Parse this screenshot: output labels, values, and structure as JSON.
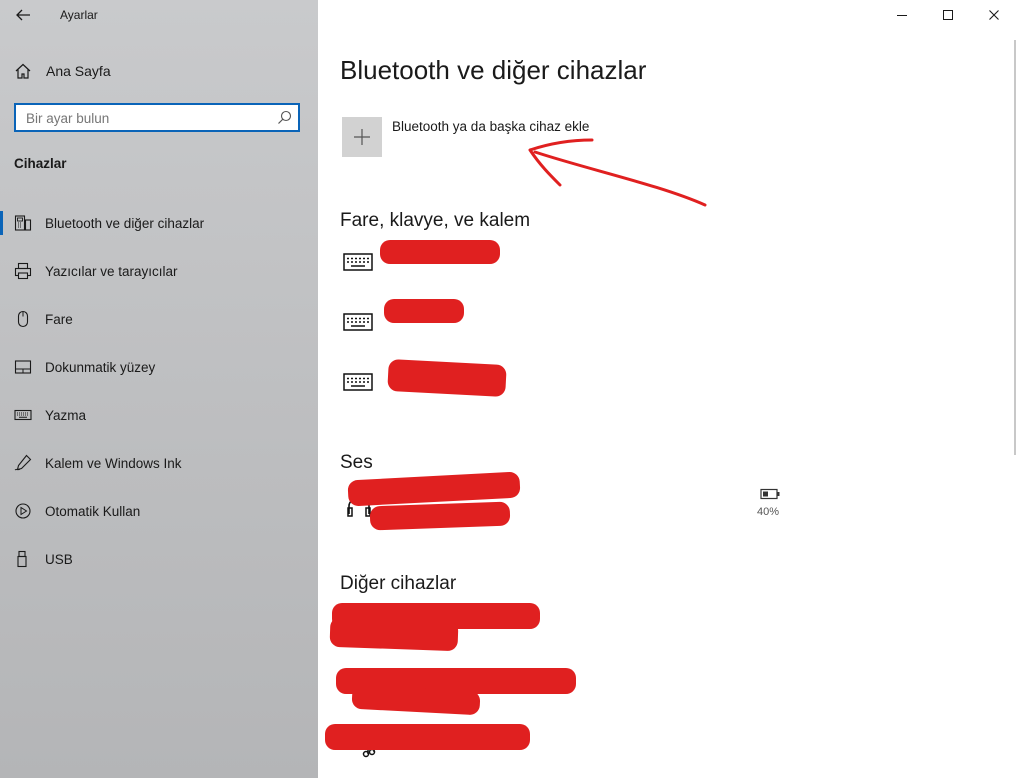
{
  "window": {
    "app_title": "Ayarlar",
    "controls": [
      "minimize",
      "maximize",
      "close"
    ]
  },
  "sidebar": {
    "home_label": "Ana Sayfa",
    "search_placeholder": "Bir ayar bulun",
    "section_label": "Cihazlar",
    "items": [
      {
        "label": "Bluetooth ve diğer cihazlar",
        "icon": "bluetooth-device-icon",
        "active": true
      },
      {
        "label": "Yazıcılar ve tarayıcılar",
        "icon": "printer-icon",
        "active": false
      },
      {
        "label": "Fare",
        "icon": "mouse-icon",
        "active": false
      },
      {
        "label": "Dokunmatik yüzey",
        "icon": "touchpad-icon",
        "active": false
      },
      {
        "label": "Yazma",
        "icon": "keyboard-icon",
        "active": false
      },
      {
        "label": "Kalem ve Windows Ink",
        "icon": "pen-icon",
        "active": false
      },
      {
        "label": "Otomatik Kullan",
        "icon": "autoplay-icon",
        "active": false
      },
      {
        "label": "USB",
        "icon": "usb-icon",
        "active": false
      }
    ]
  },
  "main": {
    "title": "Bluetooth ve diğer cihazlar",
    "add_device_label": "Bluetooth ya da başka cihaz ekle",
    "groups": {
      "input": "Fare, klavye, ve kalem",
      "audio": "Ses",
      "other": "Diğer cihazlar"
    },
    "battery_percent": "40%"
  },
  "colors": {
    "accent": "#0a64b8",
    "annotation": "#e02020",
    "sidebar_bg": "#c4c5c7"
  }
}
